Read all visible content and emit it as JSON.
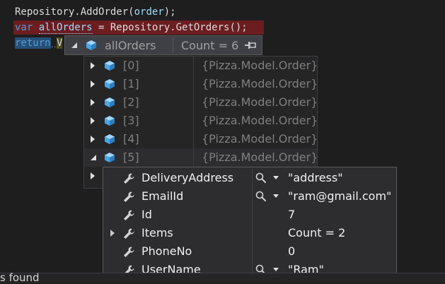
{
  "code": {
    "line1": {
      "recv": "Repository",
      "method": ".AddOrder(",
      "arg": "order",
      "end": ");"
    },
    "line2": {
      "kw": "var",
      "name": "allOrders",
      "rest": " = Repository.GetOrders();"
    },
    "line3": {
      "kw": "return",
      "name": "V"
    }
  },
  "datatip": {
    "name": "allOrders",
    "value": "Count = 6"
  },
  "array_items": [
    {
      "index": "[0]",
      "type": "{Pizza.Model.Order}"
    },
    {
      "index": "[1]",
      "type": "{Pizza.Model.Order}"
    },
    {
      "index": "[2]",
      "type": "{Pizza.Model.Order}"
    },
    {
      "index": "[3]",
      "type": "{Pizza.Model.Order}"
    },
    {
      "index": "[4]",
      "type": "{Pizza.Model.Order}"
    },
    {
      "index": "[5]",
      "type": "{Pizza.Model.Order}"
    }
  ],
  "properties": [
    {
      "name": "DeliveryAddress",
      "value": "\"address\""
    },
    {
      "name": "EmailId",
      "value": "\"ram@gmail.com\""
    },
    {
      "name": "Id",
      "value": "7"
    },
    {
      "name": "Items",
      "value": "Count = 2"
    },
    {
      "name": "PhoneNo",
      "value": "0"
    },
    {
      "name": "UserName",
      "value": "\"Ram\""
    }
  ],
  "status": {
    "text": "s found"
  },
  "colors": {
    "keyword": "#569cd6",
    "variable": "#9cdcfe",
    "error_highlight": "#6b1d20",
    "cube_icon": "#75beff"
  }
}
